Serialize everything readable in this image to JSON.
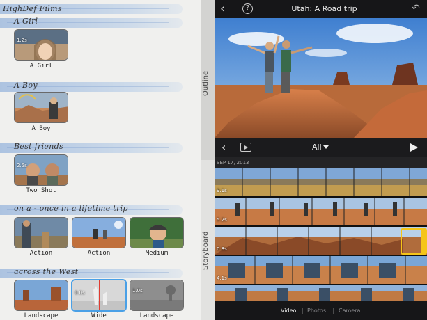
{
  "storyboard": {
    "project_label": "HighDef Films",
    "sections": [
      {
        "heading": "A Girl",
        "clips": [
          {
            "caption": "A Girl",
            "duration": "1.2s"
          }
        ]
      },
      {
        "heading": "A Boy",
        "clips": [
          {
            "caption": "A Boy",
            "duration": ""
          }
        ]
      },
      {
        "heading": "Best friends",
        "clips": [
          {
            "caption": "Two Shot",
            "duration": "2.5s"
          }
        ]
      },
      {
        "heading": "on a - once in a lifetime trip",
        "clips": [
          {
            "caption": "Action",
            "duration": ""
          },
          {
            "caption": "Action",
            "duration": ""
          },
          {
            "caption": "Medium",
            "duration": ""
          }
        ]
      },
      {
        "heading": "across the West",
        "clips": [
          {
            "caption": "Landscape",
            "duration": ""
          },
          {
            "caption": "Wide",
            "duration": "0.0s"
          },
          {
            "caption": "Landscape",
            "duration": "1.0s"
          }
        ]
      }
    ]
  },
  "side_tabs": {
    "outline": "Outline",
    "storyboard": "Storyboard"
  },
  "header": {
    "title": "Utah: A Road trip",
    "back_icon": "chevron-left-icon",
    "help_icon": "question-circle-icon",
    "undo_icon": "undo-icon"
  },
  "controls": {
    "filter_label": "All"
  },
  "media_browser": {
    "date": "SEP 17, 2013",
    "clip_durations": [
      "9.1s",
      "5.2s",
      "0.8s",
      "",
      "4.1s"
    ]
  },
  "bottom_tabs": [
    {
      "label": "Video",
      "active": true
    },
    {
      "label": "Photos",
      "active": false
    },
    {
      "label": "Camera",
      "active": false
    }
  ],
  "colors": {
    "selection": "#4aa0e6",
    "clip_handle": "#f5c518",
    "brush_blue": "#9bb8de"
  }
}
